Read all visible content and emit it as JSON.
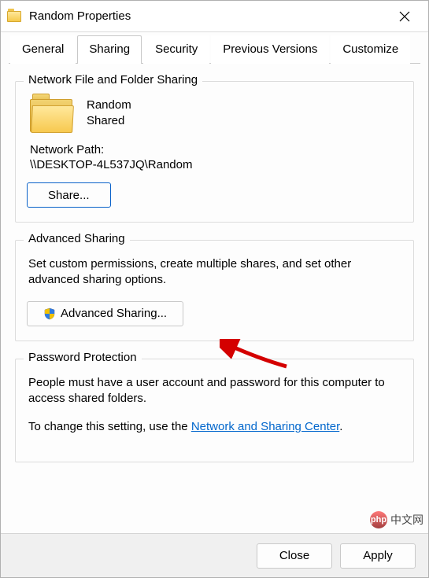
{
  "titlebar": {
    "title": "Random Properties"
  },
  "tabs": {
    "items": [
      "General",
      "Sharing",
      "Security",
      "Previous Versions",
      "Customize"
    ],
    "active_index": 1
  },
  "group_network": {
    "title": "Network File and Folder Sharing",
    "folder_name": "Random",
    "share_status": "Shared",
    "path_label": "Network Path:",
    "path_value": "\\\\DESKTOP-4L537JQ\\Random",
    "share_btn": "Share..."
  },
  "group_advanced": {
    "title": "Advanced Sharing",
    "desc": "Set custom permissions, create multiple shares, and set other advanced sharing options.",
    "button": "Advanced Sharing..."
  },
  "group_password": {
    "title": "Password Protection",
    "desc1": "People must have a user account and password for this computer to access shared folders.",
    "desc2_pre": "To change this setting, use the ",
    "desc2_link": "Network and Sharing Center",
    "desc2_post": "."
  },
  "footer": {
    "close": "Close",
    "apply": "Apply"
  },
  "watermark": {
    "text": "中文网",
    "brand": "php"
  }
}
